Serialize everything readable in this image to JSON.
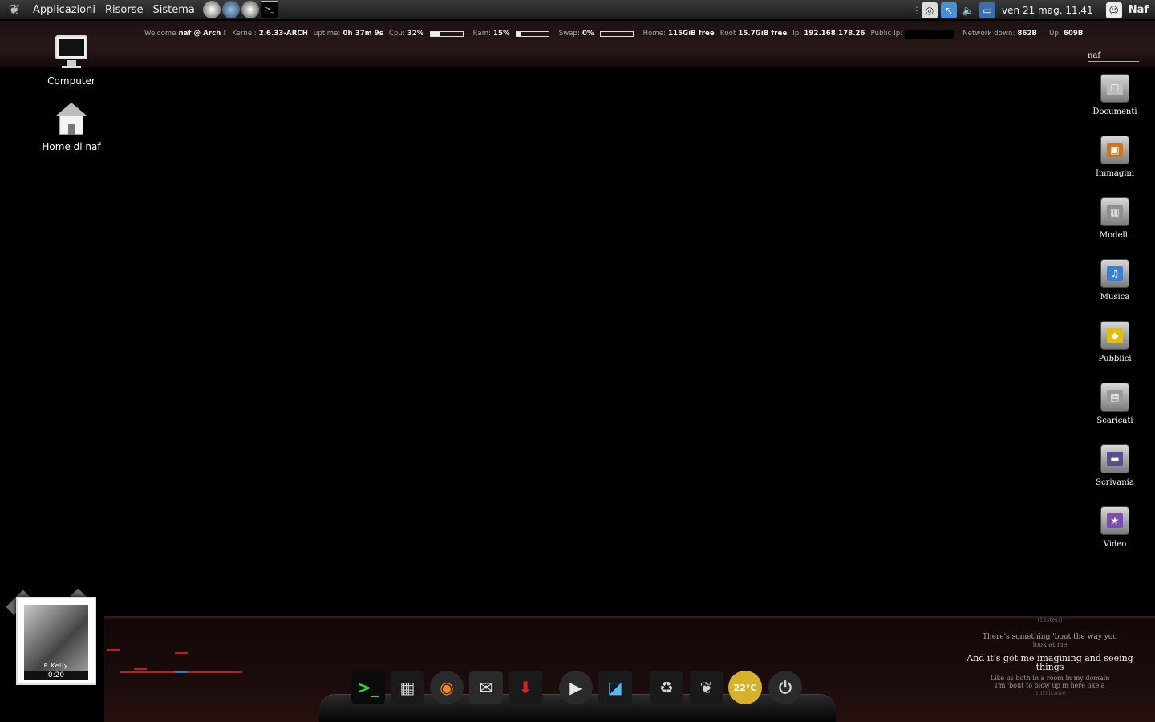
{
  "top_panel": {
    "menus": [
      "Applicazioni",
      "Risorse",
      "Sistema"
    ],
    "clock": "ven 21 mag, 11.41",
    "user": "Naf"
  },
  "conky": {
    "welcome_label": "Welcome",
    "welcome_value": "naf @ Arch !",
    "kernel_label": "Kernel:",
    "kernel_value": "2.6.33-ARCH",
    "uptime_label": "uptime:",
    "uptime_value": "0h 37m 9s",
    "cpu_label": "Cpu:",
    "cpu_value": "32%",
    "cpu_fraction": 0.32,
    "ram_label": "Ram:",
    "ram_value": "15%",
    "ram_fraction": 0.15,
    "swap_label": "Swap:",
    "swap_value": "0%",
    "swap_fraction": 0.0,
    "home_label": "Home:",
    "home_value": "115GiB free",
    "root_label": "Root",
    "root_value": "15.7GiB free",
    "ip_label": "Ip:",
    "ip_value": "192.168.178.26",
    "pubip_label": "Public Ip:",
    "netdown_label": "Network down:",
    "netdown_value": "862B",
    "up_label": "Up:",
    "up_value": "609B"
  },
  "search": {
    "value": "naf"
  },
  "desktop_left": [
    {
      "label": "Computer",
      "icon": "computer-icon"
    },
    {
      "label": "Home di naf",
      "icon": "home-icon"
    }
  ],
  "desktop_right": [
    {
      "label": "Documenti",
      "icon": "documents-folder-icon",
      "emblem": "☐",
      "color": "#bdbdbd"
    },
    {
      "label": "Immagini",
      "icon": "pictures-folder-icon",
      "emblem": "▣",
      "color": "#c9782a"
    },
    {
      "label": "Modelli",
      "icon": "templates-folder-icon",
      "emblem": "▥",
      "color": "#8f8f8f"
    },
    {
      "label": "Musica",
      "icon": "music-folder-icon",
      "emblem": "♫",
      "color": "#3a7fd4"
    },
    {
      "label": "Pubblici",
      "icon": "public-folder-icon",
      "emblem": "◆",
      "color": "#e2c000"
    },
    {
      "label": "Scaricati",
      "icon": "downloads-folder-icon",
      "emblem": "▤",
      "color": "#9a9a9a"
    },
    {
      "label": "Scrivania",
      "icon": "desktop-folder-icon",
      "emblem": "▬",
      "color": "#5a4c8e"
    },
    {
      "label": "Video",
      "icon": "video-folder-icon",
      "emblem": "★",
      "color": "#7b4fb0"
    }
  ],
  "cover": {
    "time": "0:20",
    "artist": "R.Kelly"
  },
  "dock": [
    {
      "name": "terminal-icon",
      "glyph": ">_",
      "bg": "#0b0b0b",
      "fg": "#2bdc2b"
    },
    {
      "name": "calculator-icon",
      "glyph": "▦",
      "bg": "#1a1a1a",
      "fg": "#cfcfcf"
    },
    {
      "name": "firefox-icon",
      "glyph": "◉",
      "bg": "#2a2a2a",
      "fg": "#f08a1c"
    },
    {
      "name": "mail-icon",
      "glyph": "✉",
      "bg": "#2a2a2a",
      "fg": "#e6e6e6"
    },
    {
      "name": "software-install-icon",
      "glyph": "⬇",
      "bg": "#1a1a1a",
      "fg": "#d22"
    },
    {
      "name": "media-player-icon",
      "glyph": "▶",
      "bg": "#2a2a2a",
      "fg": "#e6e6e6"
    },
    {
      "name": "image-viewer-icon",
      "glyph": "◪",
      "bg": "#1a1a1a",
      "fg": "#58b6ff"
    },
    {
      "name": "trash-icon",
      "glyph": "♻",
      "bg": "#1a1a1a",
      "fg": "#d8d8d8"
    },
    {
      "name": "gnome-foot-icon",
      "glyph": "❦",
      "bg": "#1a1a1a",
      "fg": "#cfcfcf"
    },
    {
      "name": "weather-icon",
      "glyph": "22°C",
      "bg": "#d7b12a",
      "fg": "#fff"
    },
    {
      "name": "power-icon",
      "glyph": "⏻",
      "bg": "#2a2a2a",
      "fg": "#d6d6d6"
    }
  ],
  "lyrics": {
    "lines": [
      "(Listen)",
      "There's something 'bout the way you",
      "look at me",
      "And it's got me imagining and seeing",
      "things",
      "Like us both in a room in my domain",
      "I'm 'bout to blow up in here like a",
      "hurricane"
    ]
  },
  "colors": {
    "accent_red": "#c81a1a",
    "accent_blue": "#2a7fd8"
  }
}
